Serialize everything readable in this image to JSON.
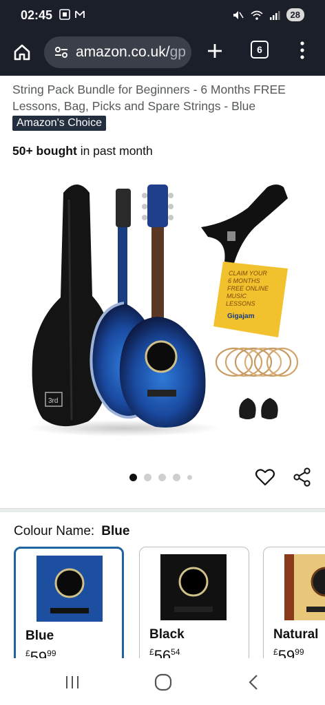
{
  "status_bar": {
    "time": "02:45",
    "battery": "28"
  },
  "browser": {
    "url_main": "amazon.co.uk/",
    "url_dim": "gp",
    "tab_count": "6"
  },
  "product": {
    "title": "String Pack Bundle for Beginners - 6 Months FREE Lessons, Bag, Picks and Spare Strings - Blue",
    "badge": "Amazon's Choice",
    "bought_bold": "50+ bought",
    "bought_rest": " in past month",
    "image_labels": {
      "bag_logo": "3rd",
      "card_text_1": "CLAIM YOUR",
      "card_text_2": "6 MONTHS",
      "card_text_3": "FREE ONLINE",
      "card_text_4": "MUSIC",
      "card_text_5": "LESSONS",
      "card_brand": "Gigajam"
    }
  },
  "carousel": {
    "dot_count": 5,
    "active_index": 0
  },
  "colour": {
    "label": "Colour Name:",
    "selected": "Blue",
    "options": [
      {
        "name": "Blue",
        "currency": "£",
        "whole": "59",
        "fraction": "99",
        "color": "#1c4fa0"
      },
      {
        "name": "Black",
        "currency": "£",
        "whole": "56",
        "fraction": "54",
        "color": "#111111"
      },
      {
        "name": "Natural",
        "currency": "£",
        "whole": "59",
        "fraction": "99",
        "color": "#e8c77a"
      }
    ]
  },
  "colors": {
    "status_bg": "#1a1f29",
    "badge_bg": "#232f3e",
    "selected_border": "#2162a1"
  }
}
